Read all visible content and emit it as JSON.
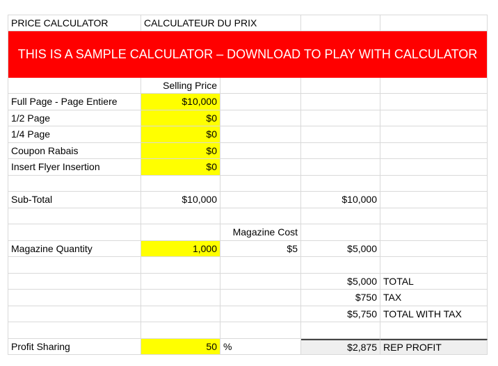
{
  "header": {
    "col_a": "PRICE CALCULATOR",
    "col_b": "CALCULATEUR DU PRIX"
  },
  "banner": {
    "text": "THIS IS A SAMPLE CALCULATOR – DOWNLOAD TO PLAY WITH CALCULATOR",
    "color": "#ff0000"
  },
  "labels": {
    "selling_price": "Selling Price",
    "magazine_cost": "Magazine Cost"
  },
  "items": [
    {
      "label": "Full Page - Page Entiere",
      "value": "$10,000"
    },
    {
      "label": "1/2 Page",
      "value": "$0"
    },
    {
      "label": "1/4 Page",
      "value": "$0"
    },
    {
      "label": "Coupon Rabais",
      "value": "$0"
    },
    {
      "label": "Insert Flyer Insertion",
      "value": "$0"
    }
  ],
  "subtotal": {
    "label": "Sub-Total",
    "value": "$10,000",
    "value2": "$10,000"
  },
  "magazine": {
    "label": "Magazine Quantity",
    "quantity": "1,000",
    "cost": "$5",
    "total": "$5,000"
  },
  "totals": [
    {
      "value": "$5,000",
      "label": "TOTAL"
    },
    {
      "value": "$750",
      "label": "TAX"
    },
    {
      "value": "$5,750",
      "label": "TOTAL WITH TAX"
    }
  ],
  "profit": {
    "label": "Profit Sharing",
    "percent": "50",
    "unit": "%",
    "value": "$2,875",
    "value_label": "REP PROFIT"
  },
  "colors": {
    "input": "#ffff00",
    "highlight": "#efefef"
  }
}
